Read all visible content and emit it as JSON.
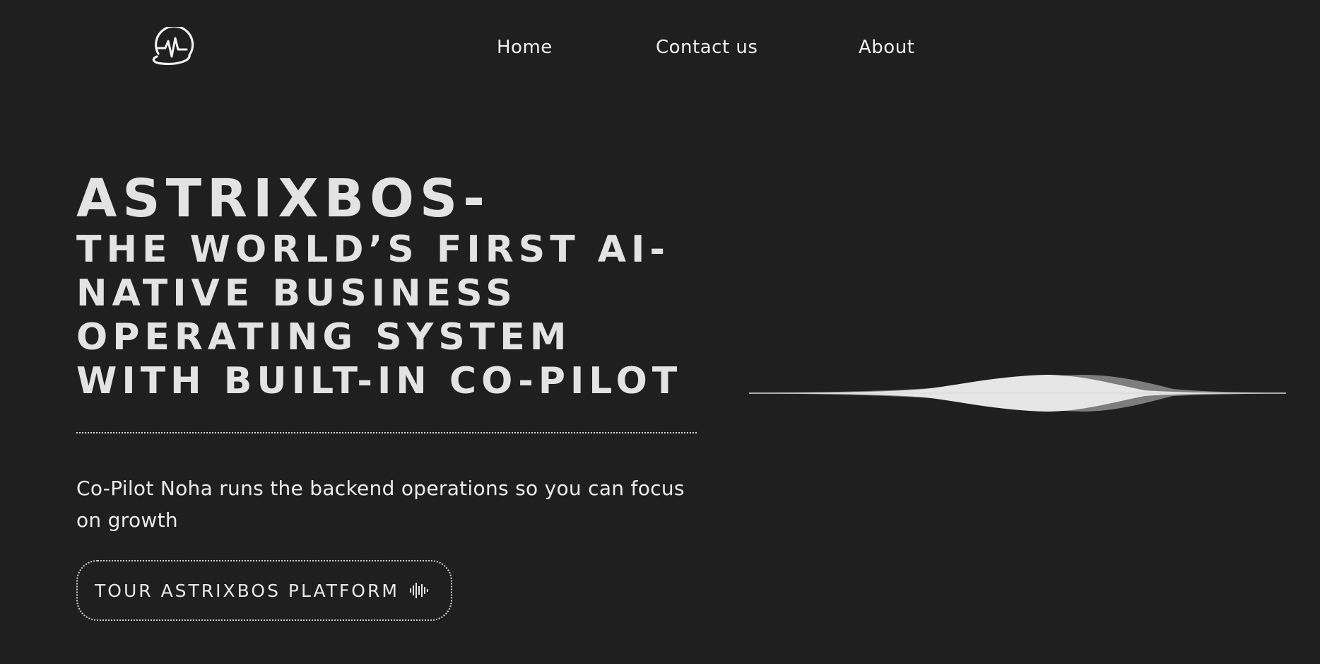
{
  "header": {
    "logo_icon": "pulse-heartbeat-logo-icon",
    "nav": {
      "home": "Home",
      "contact": "Contact us",
      "about": "About"
    }
  },
  "hero": {
    "title_line1": "ASTRIXBOS-",
    "title_line2": "THE WORLD’S FIRST AI-NATIVE BUSINESS OPERATING SYSTEM WITH BUILT-IN CO-PILOT",
    "subtitle": "Co-Pilot Noha runs the backend operations so you can focus on growth",
    "cta_label": "TOUR ASTRIXBOS PLATFORM",
    "cta_icon": "audio-waveform-icon"
  },
  "visual": {
    "waveform_icon": "sound-wave-graphic"
  },
  "colors": {
    "background": "#1f1f1f",
    "text": "#e6e6e6",
    "accent": "#ffffff"
  }
}
